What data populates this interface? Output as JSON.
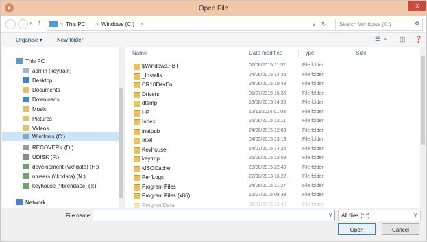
{
  "window": {
    "title": "Open File",
    "close_glyph": "x"
  },
  "address": {
    "crumbs": [
      "This PC",
      "Windows (C:)"
    ],
    "separator": ">",
    "search_placeholder": "Search Windows (C:)"
  },
  "toolbar": {
    "organise_label": "Organise ▾",
    "new_folder_label": "New folder"
  },
  "nav_pane": {
    "items": [
      {
        "label": "This PC",
        "icon": "computer-icon"
      },
      {
        "label": "admin (keytrain)",
        "icon": "user-icon"
      },
      {
        "label": "Desktop",
        "icon": "desktop-icon"
      },
      {
        "label": "Documents",
        "icon": "documents-icon"
      },
      {
        "label": "Downloads",
        "icon": "downloads-icon"
      },
      {
        "label": "Music",
        "icon": "music-icon"
      },
      {
        "label": "Pictures",
        "icon": "pictures-icon"
      },
      {
        "label": "Videos",
        "icon": "videos-icon"
      },
      {
        "label": "Windows (C:)",
        "icon": "drive-icon"
      },
      {
        "label": "RECOVERY (D:)",
        "icon": "drive-icon"
      },
      {
        "label": "UDISK (F:)",
        "icon": "usb-drive-icon"
      },
      {
        "label": "development (\\\\khdata) (H:)",
        "icon": "network-drive-icon"
      },
      {
        "label": "ntusers (\\\\khdata) (N:)",
        "icon": "network-drive-icon"
      },
      {
        "label": "keyhouse (\\\\brendapc) (T:)",
        "icon": "network-drive-icon"
      },
      {
        "label": "Network",
        "icon": "network-icon"
      }
    ],
    "selected": "Windows (C:)"
  },
  "columns": {
    "name": "Name",
    "date": "Date modified",
    "type": "Type",
    "size": "Size"
  },
  "files": [
    {
      "name": "$Windows.~BT",
      "date": "07/08/2015 11:57",
      "type": "File folder"
    },
    {
      "name": "_Installs",
      "date": "24/06/2015 14:35",
      "type": "File folder"
    },
    {
      "name": "CR10DevEn",
      "date": "24/06/2015 10:43",
      "type": "File folder"
    },
    {
      "name": "Drivers",
      "date": "01/07/2015 16:36",
      "type": "File folder"
    },
    {
      "name": "dtemp",
      "date": "13/08/2015 14:36",
      "type": "File folder"
    },
    {
      "name": "HP",
      "date": "12/11/2014 01:03",
      "type": "File folder"
    },
    {
      "name": "Index",
      "date": "25/06/2015 12:11",
      "type": "File folder"
    },
    {
      "name": "inetpub",
      "date": "24/06/2015 12:03",
      "type": "File folder"
    },
    {
      "name": "Intel",
      "date": "04/05/2015 13:13",
      "type": "File folder"
    },
    {
      "name": "Keyhouse",
      "date": "14/07/2015 14:26",
      "type": "File folder"
    },
    {
      "name": "keytmp",
      "date": "25/06/2015 12:08",
      "type": "File folder"
    },
    {
      "name": "MSOCache",
      "date": "23/06/2015 22:48",
      "type": "File folder"
    },
    {
      "name": "PerfLogs",
      "date": "22/08/2013 16:22",
      "type": "File folder"
    },
    {
      "name": "Program Files",
      "date": "24/06/2015 11:27",
      "type": "File folder"
    },
    {
      "name": "Program Files (x86)",
      "date": "16/07/2015 08:33",
      "type": "File folder"
    },
    {
      "name": "ProgramData",
      "date": "01/07/2015 15:40",
      "type": "File folder"
    }
  ],
  "footer": {
    "file_name_label": "File name:",
    "file_name_value": "",
    "filter_value": "All files (*.*)",
    "open_label": "Open",
    "cancel_label": "Cancel"
  }
}
